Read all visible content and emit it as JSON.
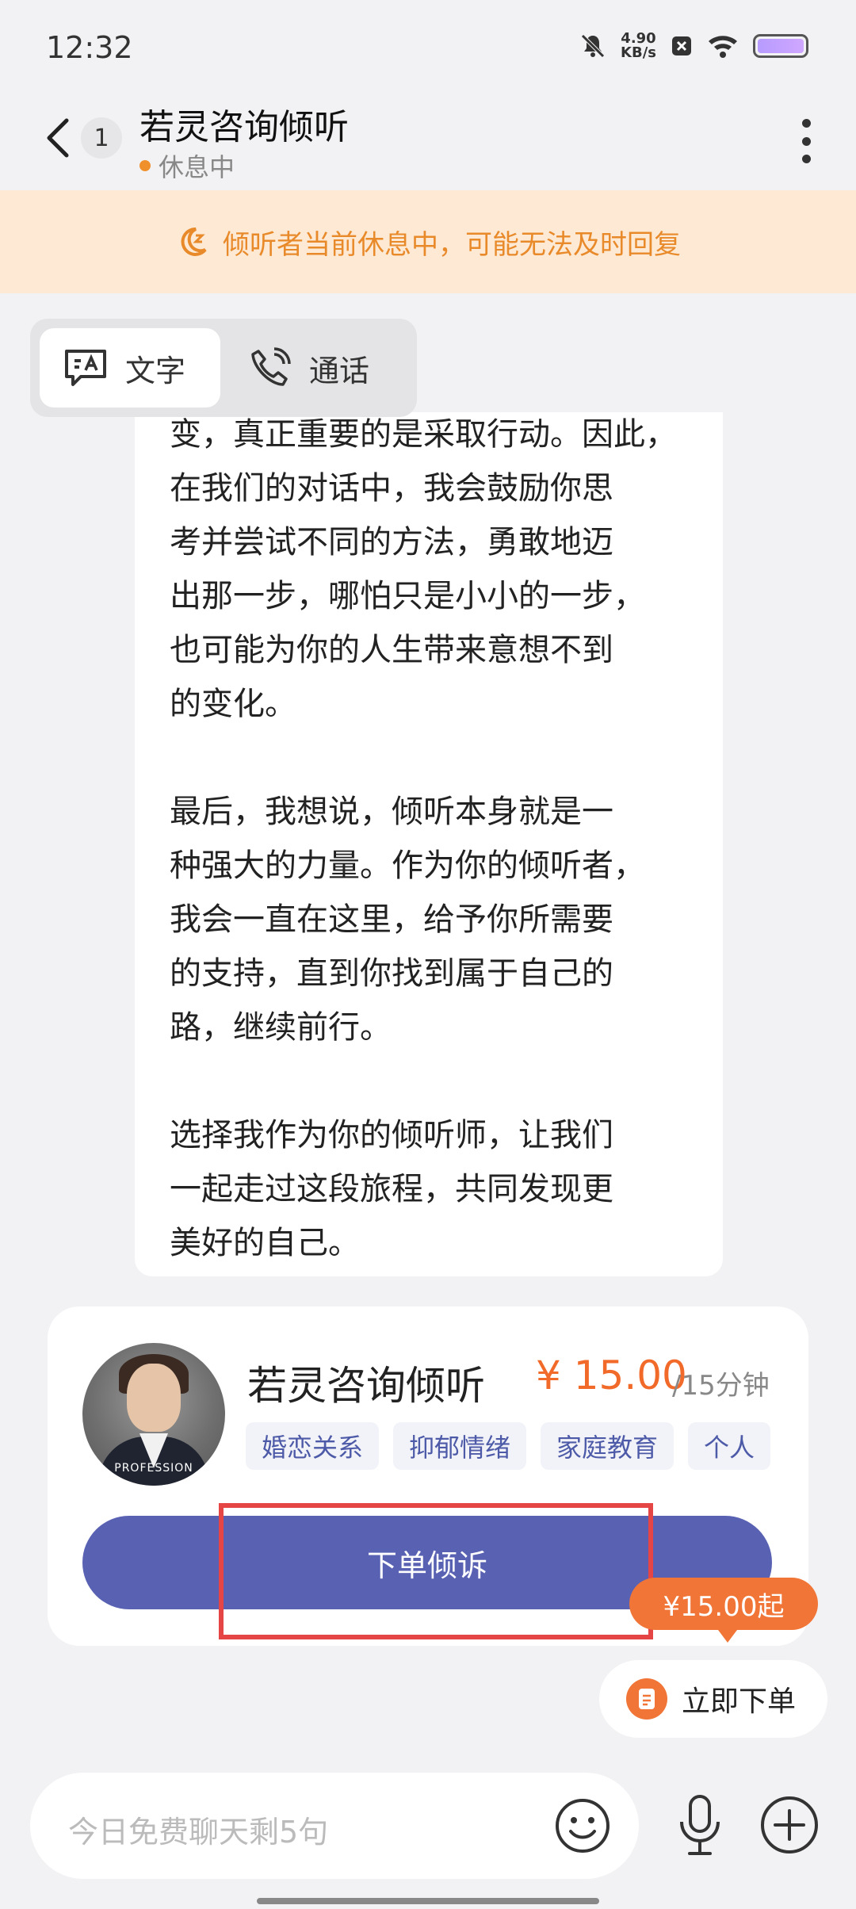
{
  "status_bar": {
    "time": "12:32",
    "net_speed": "4.90",
    "net_speed_unit": "KB/s",
    "icons": [
      "mute-bell-icon",
      "notification-x-icon",
      "wifi-icon",
      "battery-icon"
    ]
  },
  "header": {
    "back_icon": "chevron-left-icon",
    "unread_count": "1",
    "title": "若灵咨询倾听",
    "status": "休息中",
    "status_color": "#f0902b",
    "more_icon": "more-vertical-icon"
  },
  "notice": {
    "icon": "moon-icon",
    "text": "倾听者当前休息中，可能无法及时回复",
    "color": "#e98a2a",
    "background": "#fde9d4"
  },
  "mode_switch": {
    "items": [
      {
        "label": "文字",
        "icon": "text-chat-icon",
        "active": true
      },
      {
        "label": "通话",
        "icon": "phone-icon",
        "active": false
      }
    ]
  },
  "message": {
    "text": "变，真正重要的是采取行动。因此，\n在我们的对话中，我会鼓励你思\n考并尝试不同的方法，勇敢地迈\n出那一步，哪怕只是小小的一步，\n也可能为你的人生带来意想不到\n的变化。\n\n最后，我想说，倾听本身就是一\n种强大的力量。作为你的倾听者，\n我会一直在这里，给予你所需要\n的支持，直到你找到属于自己的\n路，继续前行。\n\n选择我作为你的倾听师，让我们\n一起走过这段旅程，共同发现更\n美好的自己。"
  },
  "card": {
    "avatar_caption": "PROFESSION",
    "name": "若灵咨询倾听",
    "price": "¥ 15.00",
    "per": "/15分钟",
    "tags": [
      "婚恋关系",
      "抑郁情绪",
      "家庭教育",
      "个人"
    ],
    "order_button": "下单倾诉",
    "accent": "#5961b3",
    "price_color": "#f26a2a"
  },
  "floating": {
    "price_pill": "¥15.00起",
    "order_label": "立即下单",
    "order_icon": "document-icon"
  },
  "input_bar": {
    "placeholder": "今日免费聊天剩5句",
    "emoji_icon": "emoji-icon",
    "mic_icon": "microphone-icon",
    "plus_icon": "plus-circle-icon"
  }
}
